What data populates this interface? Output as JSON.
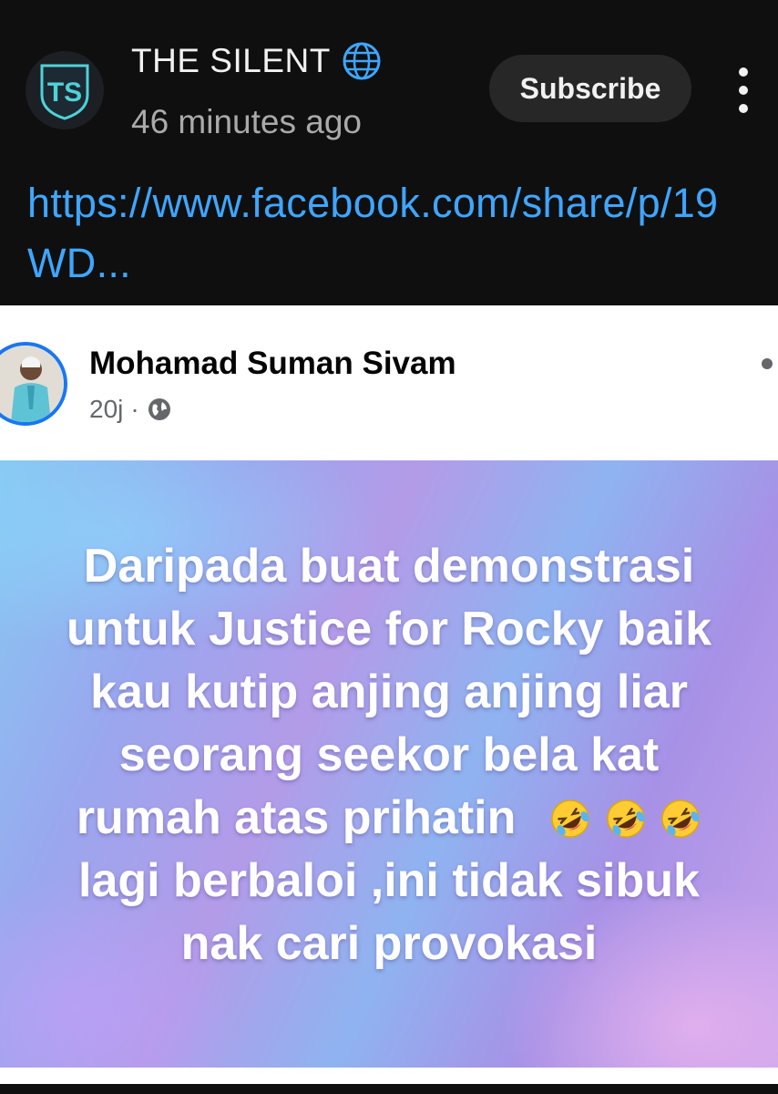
{
  "channel": {
    "name": "THE SILENT",
    "logo_text": "TS",
    "time": "46 minutes ago",
    "subscribe_label": "Subscribe",
    "badge_icon": "globe-icon",
    "more_icon": "more-vertical-icon"
  },
  "post": {
    "link": "https://www.facebook.com/share/p/19WD..."
  },
  "facebook_post": {
    "author": "Mohamad Suman Sivam",
    "time": "20j",
    "separator": "·",
    "privacy_icon": "globe-icon",
    "image_text_lines": [
      "Daripada buat demonstrasi",
      "untuk Justice for Rocky baik",
      "kau kutip anjing anjing liar",
      "seorang seekor bela kat",
      "rumah atas prihatin",
      "lagi berbaloi ,ini tidak sibuk",
      "nak cari provokasi"
    ],
    "emoji": "rolling-on-floor-laughing-emoji",
    "emoji_count": 3
  },
  "colors": {
    "background": "#0f0f0f",
    "link": "#3ea6ff",
    "fb_accent": "#1877f2",
    "logo_teal": "#4fd1d9"
  }
}
